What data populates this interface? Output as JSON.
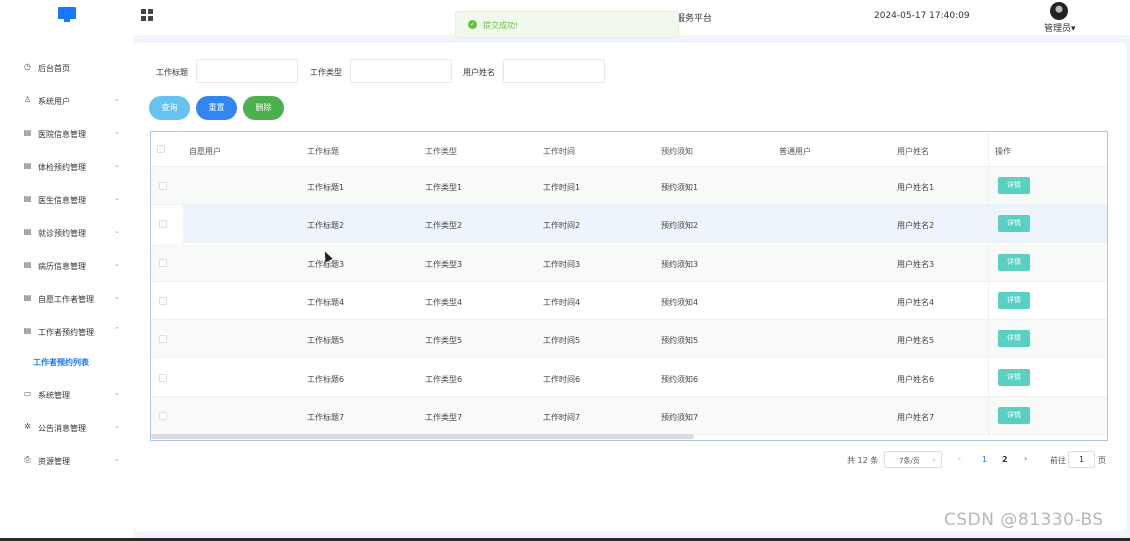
{
  "header": {
    "site_title": "服务平台",
    "datetime": "2024-05-17 17:40:09",
    "user_label": "管理员",
    "user_chevron": "▾"
  },
  "toast": {
    "message": "提交成功!"
  },
  "sidebar": {
    "items": [
      {
        "label": "后台首页",
        "icon": "clock-icon",
        "glyph": "◷",
        "chevron": ""
      },
      {
        "label": "系统用户",
        "icon": "user-icon",
        "glyph": "♙",
        "chevron": "⌄"
      },
      {
        "label": "医院信息管理",
        "icon": "card-icon",
        "glyph": "▤",
        "chevron": "⌄"
      },
      {
        "label": "体检预约管理",
        "icon": "card-icon",
        "glyph": "▤",
        "chevron": "⌄"
      },
      {
        "label": "医生信息管理",
        "icon": "card-icon",
        "glyph": "▤",
        "chevron": "⌄"
      },
      {
        "label": "就诊预约管理",
        "icon": "card-icon",
        "glyph": "▤",
        "chevron": "⌄"
      },
      {
        "label": "病历信息管理",
        "icon": "card-icon",
        "glyph": "▤",
        "chevron": "⌄"
      },
      {
        "label": "自愿工作者管理",
        "icon": "card-icon",
        "glyph": "▤",
        "chevron": "⌄"
      },
      {
        "label": "工作者预约管理",
        "icon": "card-icon",
        "glyph": "▤",
        "chevron": "⌃"
      },
      {
        "label": "系统管理",
        "icon": "folder-icon",
        "glyph": "▭",
        "chevron": "⌄"
      },
      {
        "label": "公告消息管理",
        "icon": "sparkle-icon",
        "glyph": "✲",
        "chevron": "⌄"
      },
      {
        "label": "资源管理",
        "icon": "printer-icon",
        "glyph": "⎙",
        "chevron": "⌄"
      }
    ],
    "active_sub": "工作者预约列表"
  },
  "search": {
    "title_label": "工作标题",
    "type_label": "工作类型",
    "name_label": "用户姓名"
  },
  "buttons": {
    "query": "查询",
    "reset": "重置",
    "delete": "删除"
  },
  "table": {
    "headers": [
      "自愿用户",
      "工作标题",
      "工作类型",
      "工作时间",
      "预约须知",
      "普通用户",
      "用户姓名",
      "操作"
    ],
    "detail_label": "详情",
    "rows": [
      {
        "title": "工作标题1",
        "type": "工作类型1",
        "time": "工作时间1",
        "notice": "预约须知1",
        "name": "用户姓名1"
      },
      {
        "title": "工作标题2",
        "type": "工作类型2",
        "time": "工作时间2",
        "notice": "预约须知2",
        "name": "用户姓名2"
      },
      {
        "title": "工作标题3",
        "type": "工作类型3",
        "time": "工作时间3",
        "notice": "预约须知3",
        "name": "用户姓名3"
      },
      {
        "title": "工作标题4",
        "type": "工作类型4",
        "time": "工作时间4",
        "notice": "预约须知4",
        "name": "用户姓名4"
      },
      {
        "title": "工作标题5",
        "type": "工作类型5",
        "time": "工作时间5",
        "notice": "预约须知5",
        "name": "用户姓名5"
      },
      {
        "title": "工作标题6",
        "type": "工作类型6",
        "time": "工作时间6",
        "notice": "预约须知6",
        "name": "用户姓名6"
      },
      {
        "title": "工作标题7",
        "type": "工作类型7",
        "time": "工作时间7",
        "notice": "预约须知7",
        "name": "用户姓名7"
      }
    ]
  },
  "pagination": {
    "total": "共 12 条",
    "page_size": "7条/页",
    "pages": [
      "1",
      "2"
    ],
    "current_page": "1",
    "goto_label": "前往",
    "goto_value": "1",
    "page_suffix": "页",
    "prev": "‹",
    "next": "›",
    "size_chevron": "⌄"
  },
  "watermark": "CSDN @81330-BS",
  "colors": {
    "accent": "#1677ff",
    "success": "#67c23a",
    "detail": "#5ad0c2",
    "delete": "#4caf50"
  }
}
